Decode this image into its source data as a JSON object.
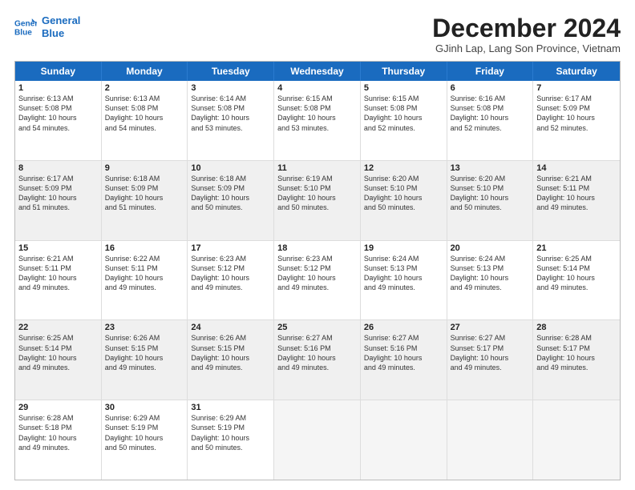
{
  "logo": {
    "line1": "General",
    "line2": "Blue"
  },
  "title": "December 2024",
  "location": "GJinh Lap, Lang Son Province, Vietnam",
  "header_days": [
    "Sunday",
    "Monday",
    "Tuesday",
    "Wednesday",
    "Thursday",
    "Friday",
    "Saturday"
  ],
  "weeks": [
    [
      {
        "day": "1",
        "lines": [
          "Sunrise: 6:13 AM",
          "Sunset: 5:08 PM",
          "Daylight: 10 hours",
          "and 54 minutes."
        ]
      },
      {
        "day": "2",
        "lines": [
          "Sunrise: 6:13 AM",
          "Sunset: 5:08 PM",
          "Daylight: 10 hours",
          "and 54 minutes."
        ]
      },
      {
        "day": "3",
        "lines": [
          "Sunrise: 6:14 AM",
          "Sunset: 5:08 PM",
          "Daylight: 10 hours",
          "and 53 minutes."
        ]
      },
      {
        "day": "4",
        "lines": [
          "Sunrise: 6:15 AM",
          "Sunset: 5:08 PM",
          "Daylight: 10 hours",
          "and 53 minutes."
        ]
      },
      {
        "day": "5",
        "lines": [
          "Sunrise: 6:15 AM",
          "Sunset: 5:08 PM",
          "Daylight: 10 hours",
          "and 52 minutes."
        ]
      },
      {
        "day": "6",
        "lines": [
          "Sunrise: 6:16 AM",
          "Sunset: 5:08 PM",
          "Daylight: 10 hours",
          "and 52 minutes."
        ]
      },
      {
        "day": "7",
        "lines": [
          "Sunrise: 6:17 AM",
          "Sunset: 5:09 PM",
          "Daylight: 10 hours",
          "and 52 minutes."
        ]
      }
    ],
    [
      {
        "day": "8",
        "lines": [
          "Sunrise: 6:17 AM",
          "Sunset: 5:09 PM",
          "Daylight: 10 hours",
          "and 51 minutes."
        ]
      },
      {
        "day": "9",
        "lines": [
          "Sunrise: 6:18 AM",
          "Sunset: 5:09 PM",
          "Daylight: 10 hours",
          "and 51 minutes."
        ]
      },
      {
        "day": "10",
        "lines": [
          "Sunrise: 6:18 AM",
          "Sunset: 5:09 PM",
          "Daylight: 10 hours",
          "and 50 minutes."
        ]
      },
      {
        "day": "11",
        "lines": [
          "Sunrise: 6:19 AM",
          "Sunset: 5:10 PM",
          "Daylight: 10 hours",
          "and 50 minutes."
        ]
      },
      {
        "day": "12",
        "lines": [
          "Sunrise: 6:20 AM",
          "Sunset: 5:10 PM",
          "Daylight: 10 hours",
          "and 50 minutes."
        ]
      },
      {
        "day": "13",
        "lines": [
          "Sunrise: 6:20 AM",
          "Sunset: 5:10 PM",
          "Daylight: 10 hours",
          "and 50 minutes."
        ]
      },
      {
        "day": "14",
        "lines": [
          "Sunrise: 6:21 AM",
          "Sunset: 5:11 PM",
          "Daylight: 10 hours",
          "and 49 minutes."
        ]
      }
    ],
    [
      {
        "day": "15",
        "lines": [
          "Sunrise: 6:21 AM",
          "Sunset: 5:11 PM",
          "Daylight: 10 hours",
          "and 49 minutes."
        ]
      },
      {
        "day": "16",
        "lines": [
          "Sunrise: 6:22 AM",
          "Sunset: 5:11 PM",
          "Daylight: 10 hours",
          "and 49 minutes."
        ]
      },
      {
        "day": "17",
        "lines": [
          "Sunrise: 6:23 AM",
          "Sunset: 5:12 PM",
          "Daylight: 10 hours",
          "and 49 minutes."
        ]
      },
      {
        "day": "18",
        "lines": [
          "Sunrise: 6:23 AM",
          "Sunset: 5:12 PM",
          "Daylight: 10 hours",
          "and 49 minutes."
        ]
      },
      {
        "day": "19",
        "lines": [
          "Sunrise: 6:24 AM",
          "Sunset: 5:13 PM",
          "Daylight: 10 hours",
          "and 49 minutes."
        ]
      },
      {
        "day": "20",
        "lines": [
          "Sunrise: 6:24 AM",
          "Sunset: 5:13 PM",
          "Daylight: 10 hours",
          "and 49 minutes."
        ]
      },
      {
        "day": "21",
        "lines": [
          "Sunrise: 6:25 AM",
          "Sunset: 5:14 PM",
          "Daylight: 10 hours",
          "and 49 minutes."
        ]
      }
    ],
    [
      {
        "day": "22",
        "lines": [
          "Sunrise: 6:25 AM",
          "Sunset: 5:14 PM",
          "Daylight: 10 hours",
          "and 49 minutes."
        ]
      },
      {
        "day": "23",
        "lines": [
          "Sunrise: 6:26 AM",
          "Sunset: 5:15 PM",
          "Daylight: 10 hours",
          "and 49 minutes."
        ]
      },
      {
        "day": "24",
        "lines": [
          "Sunrise: 6:26 AM",
          "Sunset: 5:15 PM",
          "Daylight: 10 hours",
          "and 49 minutes."
        ]
      },
      {
        "day": "25",
        "lines": [
          "Sunrise: 6:27 AM",
          "Sunset: 5:16 PM",
          "Daylight: 10 hours",
          "and 49 minutes."
        ]
      },
      {
        "day": "26",
        "lines": [
          "Sunrise: 6:27 AM",
          "Sunset: 5:16 PM",
          "Daylight: 10 hours",
          "and 49 minutes."
        ]
      },
      {
        "day": "27",
        "lines": [
          "Sunrise: 6:27 AM",
          "Sunset: 5:17 PM",
          "Daylight: 10 hours",
          "and 49 minutes."
        ]
      },
      {
        "day": "28",
        "lines": [
          "Sunrise: 6:28 AM",
          "Sunset: 5:17 PM",
          "Daylight: 10 hours",
          "and 49 minutes."
        ]
      }
    ],
    [
      {
        "day": "29",
        "lines": [
          "Sunrise: 6:28 AM",
          "Sunset: 5:18 PM",
          "Daylight: 10 hours",
          "and 49 minutes."
        ]
      },
      {
        "day": "30",
        "lines": [
          "Sunrise: 6:29 AM",
          "Sunset: 5:19 PM",
          "Daylight: 10 hours",
          "and 50 minutes."
        ]
      },
      {
        "day": "31",
        "lines": [
          "Sunrise: 6:29 AM",
          "Sunset: 5:19 PM",
          "Daylight: 10 hours",
          "and 50 minutes."
        ]
      },
      {
        "day": "",
        "lines": []
      },
      {
        "day": "",
        "lines": []
      },
      {
        "day": "",
        "lines": []
      },
      {
        "day": "",
        "lines": []
      }
    ]
  ]
}
